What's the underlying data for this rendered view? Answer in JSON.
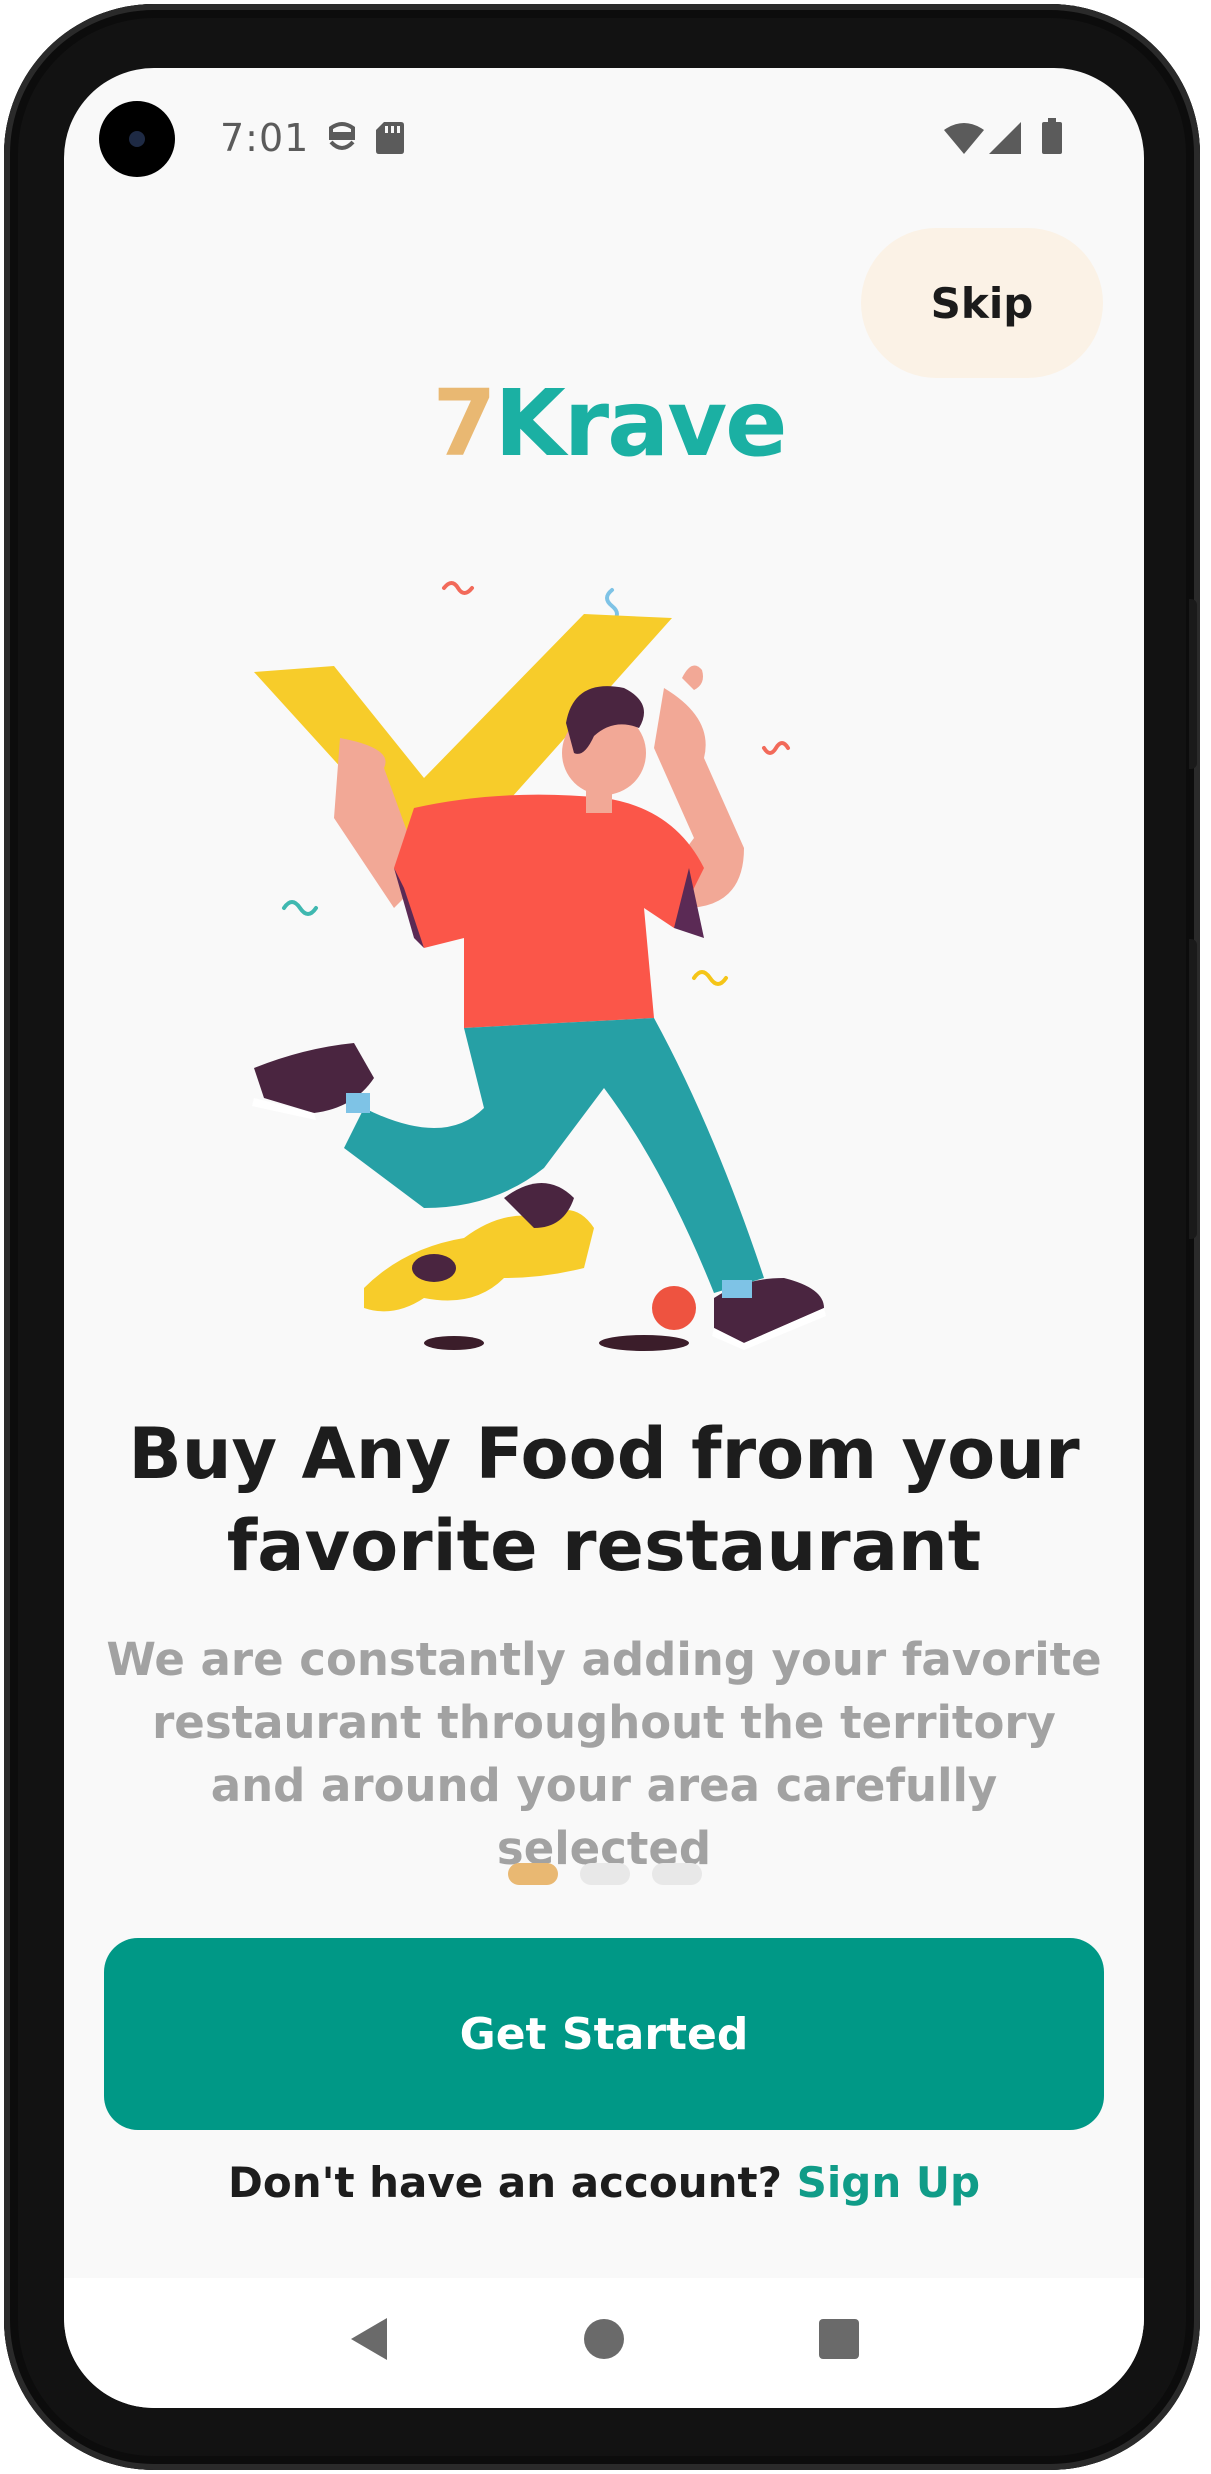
{
  "status_bar": {
    "time": "7:01",
    "icons": [
      "do-not-disturb-icon",
      "sd-card-icon",
      "wifi-icon",
      "cell-signal-icon",
      "battery-icon"
    ]
  },
  "skip_label": "Skip",
  "logo": {
    "part1": "7",
    "part2": "Krave",
    "colors": {
      "seven": "#e9b872",
      "krave": "#1bb0a3"
    }
  },
  "illustration": {
    "icon": "person-running-with-checkmark-and-dog-illustration"
  },
  "headline": "Buy Any Food from your favorite restaurant",
  "subtext": "We are constantly adding your favorite restaurant throughout the territory and around your area carefully selected",
  "pager": {
    "total": 3,
    "active": 1
  },
  "primary_button_label": "Get Started",
  "signup": {
    "prompt": "Don't have an account?",
    "link": "Sign Up"
  },
  "nav": {
    "back": "back-icon",
    "home": "home-icon",
    "recents": "recents-icon"
  },
  "colors": {
    "primary": "#009886",
    "accent": "#e9b872",
    "link": "#109c88",
    "skip_bg": "#fbf2e6"
  }
}
